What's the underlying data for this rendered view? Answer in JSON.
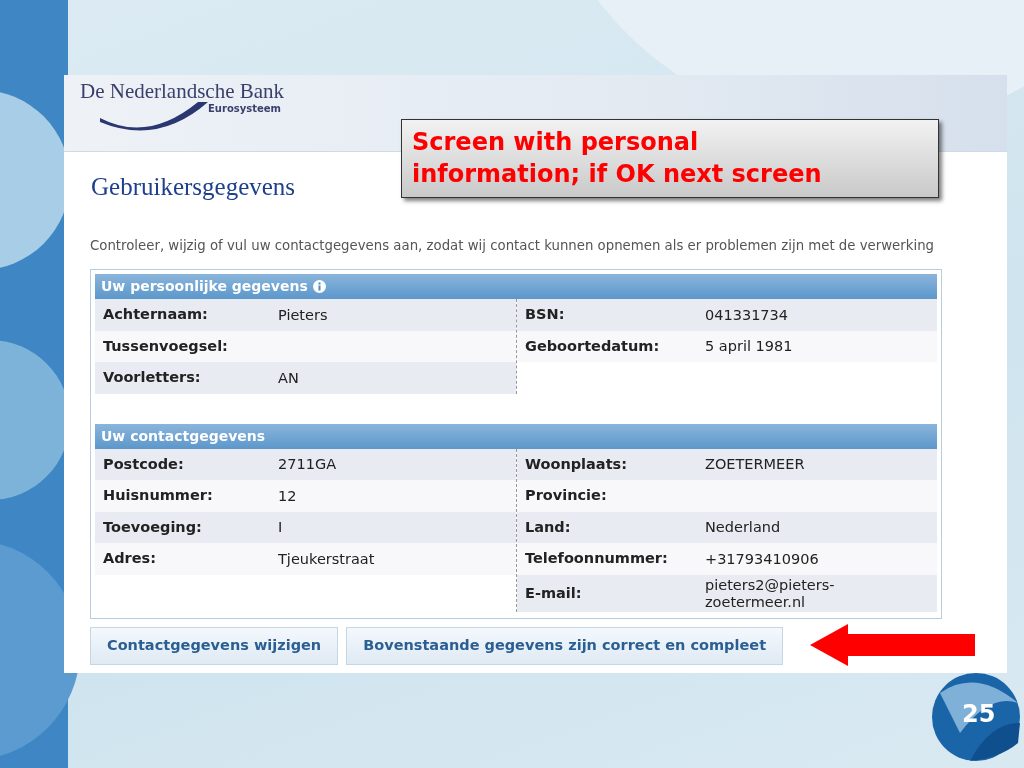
{
  "slide": {
    "callout": "Screen with personal information; if OK next screen",
    "number": "25"
  },
  "screen": {
    "logo": {
      "name": "De Nederlandsche Bank",
      "subtitle": "Eurosysteem"
    },
    "title": "Gebruikersgegevens",
    "intro": "Controleer, wijzig of vul uw contactgegevens aan, zodat wij contact kunnen opnemen als er problemen zijn met de verwerking",
    "sections": [
      {
        "title": "Uw persoonlijke gegevens",
        "info": true,
        "left": [
          {
            "label": "Achternaam:",
            "value": "Pieters"
          },
          {
            "label": "Tussenvoegsel:"
          },
          {
            "label": "Voorletters:",
            "value": "AN"
          }
        ],
        "right": [
          {
            "label": "BSN:",
            "value": "041331734"
          },
          {
            "label": "Geboortedatum:",
            "value": "5 april 1981"
          }
        ]
      },
      {
        "title": "Uw contactgegevens",
        "info": false,
        "left": [
          {
            "label": "Postcode:",
            "value": "2711GA"
          },
          {
            "label": "Huisnummer:",
            "value": "12"
          },
          {
            "label": "Toevoeging:",
            "value": "I"
          },
          {
            "label": "Adres:",
            "value": "Tjeukerstraat"
          }
        ],
        "right": [
          {
            "label": "Woonplaats:",
            "value": "ZOETERMEER"
          },
          {
            "label": "Provincie:"
          },
          {
            "label": "Land:",
            "value": "Nederland"
          },
          {
            "label": "Telefoonnummer:",
            "value": "+31793410906"
          },
          {
            "label": "E-mail:",
            "value": "pieters2@pieters-zoetermeer.nl"
          }
        ]
      }
    ],
    "buttons": [
      "Contactgegevens wijzigen",
      "Bovenstaande gegevens zijn correct en compleet"
    ]
  }
}
